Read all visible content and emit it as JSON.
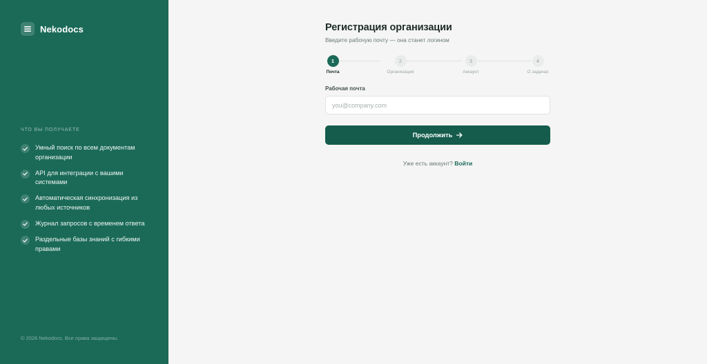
{
  "sidebar": {
    "brand": "Nekodocs",
    "logo_icon": "menu-icon",
    "benefits_title": "ЧТО ВЫ ПОЛУЧАЕТЕ",
    "benefits": [
      {
        "line1": "Умный поиск по всем документам",
        "line2": "организации"
      },
      {
        "line1": "API для интеграции с вашими",
        "line2": "системами"
      },
      {
        "line1": "Автоматическая синхронизация из",
        "line2": "любых источников"
      },
      {
        "line1": "Журнал запросов с временем ответа",
        "line2": ""
      },
      {
        "line1": "Раздельные базы знаний с гибкими",
        "line2": "правами"
      }
    ],
    "copyright": "© 2026 Nekodocs. Все права защищены."
  },
  "form": {
    "title": "Регистрация организации",
    "subtitle": "Введите рабочую почту — она станет логином",
    "steps": [
      {
        "number": "1",
        "label": "Почта",
        "active": true
      },
      {
        "number": "2",
        "label": "Организация",
        "active": false
      },
      {
        "number": "3",
        "label": "Аккаунт",
        "active": false
      },
      {
        "number": "4",
        "label": "О задачах",
        "active": false
      }
    ],
    "email_label": "Рабочая почта",
    "email_placeholder": "you@company.com",
    "email_value": "",
    "continue_label": "Продолжить",
    "have_account": "Уже есть аккаунт?",
    "login_link": "Войти"
  },
  "colors": {
    "sidebar_bg": "#1b6a58",
    "accent": "#155c4c",
    "page_bg": "#f4f5f4"
  }
}
